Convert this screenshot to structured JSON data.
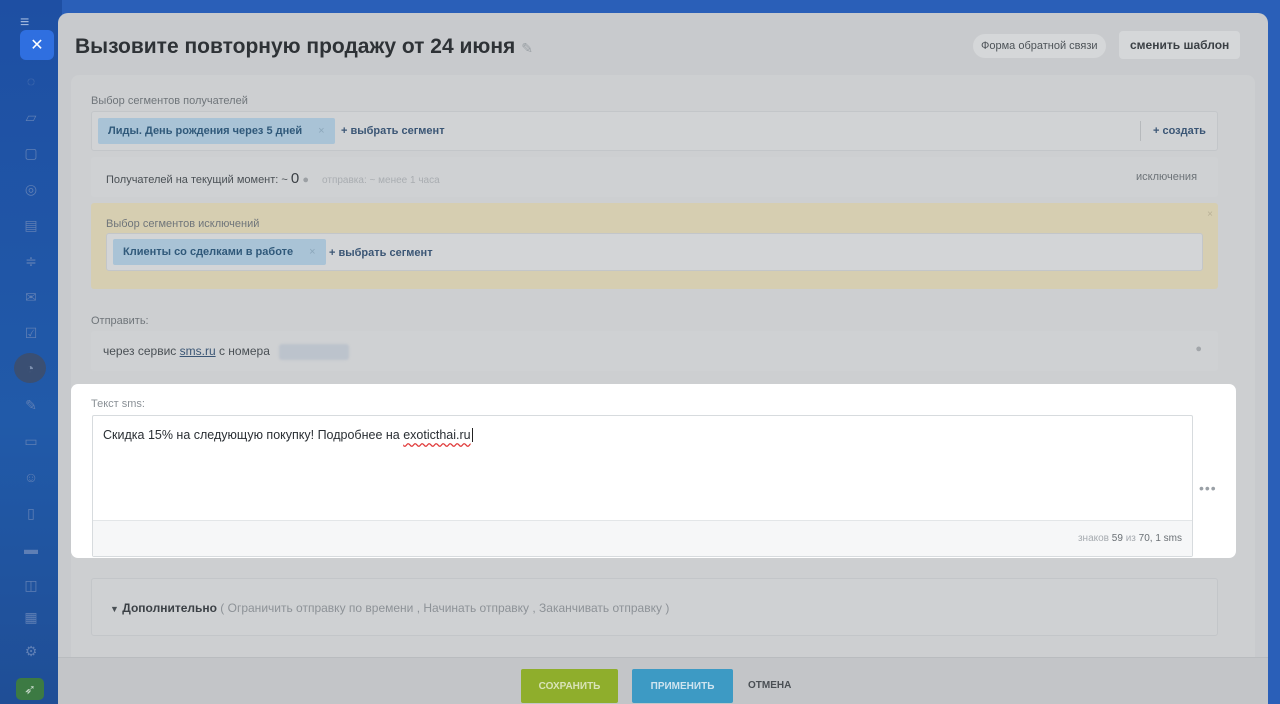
{
  "rail": {
    "icons": [
      "menu-icon",
      "close-icon",
      "feed-icon",
      "tasks-icon",
      "chat-icon",
      "calendar-icon",
      "docs-icon",
      "funnel-icon",
      "mail-icon",
      "check-icon",
      "marketing-icon",
      "pen-icon",
      "screen-icon",
      "contacts-icon",
      "document-icon",
      "card-icon",
      "robot-icon",
      "calendar2-icon",
      "settings-icon",
      "rocket-icon"
    ]
  },
  "header": {
    "title": "Вызовите повторную продажу от 24 июня",
    "feedback_label": "Форма обратной связи",
    "template_label": "сменить шаблон"
  },
  "recipients": {
    "label": "Выбор сегментов получателей",
    "segment": "Лиды. День рождения через 5 дней",
    "add_segment": "+ выбрать сегмент",
    "create": "+ создать",
    "count_label": "Получателей на текущий момент: ~",
    "count_value": "0",
    "send_time": "отправка: ~ менее 1 часа",
    "exclusions_link": "исключения"
  },
  "exclusions": {
    "label": "Выбор сегментов исключений",
    "segment": "Клиенты со сделками в работе",
    "add_segment": "+ выбрать сегмент"
  },
  "send": {
    "label": "Отправить:",
    "via_prefix": "через сервис",
    "service": "sms.ru",
    "via_suffix": "с номера"
  },
  "sms": {
    "label": "Текст sms:",
    "text_main": "Скидка 15% на следующую покупку! Подробнее на ",
    "text_link": "exoticthai.ru",
    "counter_prefix": "знаков",
    "counter_count": "59",
    "counter_of": "из",
    "counter_max": "70",
    "counter_sms": ", 1 sms"
  },
  "additional": {
    "title": "Дополнительно",
    "options": "( Ограничить отправку по времени ,  Начинать отправку ,  Заканчивать отправку )"
  },
  "footer": {
    "save": "СОХРАНИТЬ",
    "apply": "ПРИМЕНИТЬ",
    "cancel": "ОТМЕНА"
  }
}
